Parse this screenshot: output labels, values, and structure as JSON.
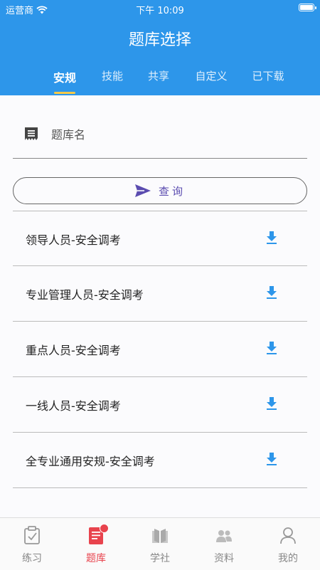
{
  "status_bar": {
    "carrier": "运营商",
    "time": "下午 10:09",
    "battery_level": 1.0
  },
  "header": {
    "title": "题库选择"
  },
  "tabs": [
    {
      "label": "安规",
      "active": true
    },
    {
      "label": "技能",
      "active": false
    },
    {
      "label": "共享",
      "active": false
    },
    {
      "label": "自定义",
      "active": false
    },
    {
      "label": "已下载",
      "active": false
    }
  ],
  "search": {
    "placeholder": "题库名",
    "value": ""
  },
  "query_button": {
    "label": "查询"
  },
  "items": [
    {
      "label": "领导人员-安全调考"
    },
    {
      "label": "专业管理人员-安全调考"
    },
    {
      "label": "重点人员-安全调考"
    },
    {
      "label": "一线人员-安全调考"
    },
    {
      "label": "全专业通用安规-安全调考"
    }
  ],
  "tabbar": [
    {
      "label": "练习",
      "icon": "practice-icon"
    },
    {
      "label": "题库",
      "icon": "question-bank-icon",
      "active": true,
      "badge": true
    },
    {
      "label": "学社",
      "icon": "book-icon"
    },
    {
      "label": "资料",
      "icon": "people-icon"
    },
    {
      "label": "我的",
      "icon": "profile-icon"
    }
  ],
  "colors": {
    "primary": "#2d96ea",
    "tab_underline": "#f7c948",
    "accent_red": "#e8434d",
    "query_text": "#5b4cb0",
    "download_icon": "#2d96ea"
  }
}
